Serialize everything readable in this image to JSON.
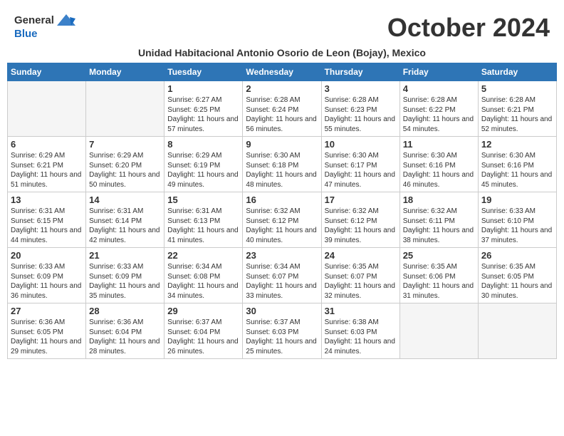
{
  "logo": {
    "text_general": "General",
    "text_blue": "Blue"
  },
  "month": "October 2024",
  "subtitle": "Unidad Habitacional Antonio Osorio de Leon (Bojay), Mexico",
  "weekdays": [
    "Sunday",
    "Monday",
    "Tuesday",
    "Wednesday",
    "Thursday",
    "Friday",
    "Saturday"
  ],
  "weeks": [
    [
      {
        "day": "",
        "info": ""
      },
      {
        "day": "",
        "info": ""
      },
      {
        "day": "1",
        "info": "Sunrise: 6:27 AM\nSunset: 6:25 PM\nDaylight: 11 hours and 57 minutes."
      },
      {
        "day": "2",
        "info": "Sunrise: 6:28 AM\nSunset: 6:24 PM\nDaylight: 11 hours and 56 minutes."
      },
      {
        "day": "3",
        "info": "Sunrise: 6:28 AM\nSunset: 6:23 PM\nDaylight: 11 hours and 55 minutes."
      },
      {
        "day": "4",
        "info": "Sunrise: 6:28 AM\nSunset: 6:22 PM\nDaylight: 11 hours and 54 minutes."
      },
      {
        "day": "5",
        "info": "Sunrise: 6:28 AM\nSunset: 6:21 PM\nDaylight: 11 hours and 52 minutes."
      }
    ],
    [
      {
        "day": "6",
        "info": "Sunrise: 6:29 AM\nSunset: 6:21 PM\nDaylight: 11 hours and 51 minutes."
      },
      {
        "day": "7",
        "info": "Sunrise: 6:29 AM\nSunset: 6:20 PM\nDaylight: 11 hours and 50 minutes."
      },
      {
        "day": "8",
        "info": "Sunrise: 6:29 AM\nSunset: 6:19 PM\nDaylight: 11 hours and 49 minutes."
      },
      {
        "day": "9",
        "info": "Sunrise: 6:30 AM\nSunset: 6:18 PM\nDaylight: 11 hours and 48 minutes."
      },
      {
        "day": "10",
        "info": "Sunrise: 6:30 AM\nSunset: 6:17 PM\nDaylight: 11 hours and 47 minutes."
      },
      {
        "day": "11",
        "info": "Sunrise: 6:30 AM\nSunset: 6:16 PM\nDaylight: 11 hours and 46 minutes."
      },
      {
        "day": "12",
        "info": "Sunrise: 6:30 AM\nSunset: 6:16 PM\nDaylight: 11 hours and 45 minutes."
      }
    ],
    [
      {
        "day": "13",
        "info": "Sunrise: 6:31 AM\nSunset: 6:15 PM\nDaylight: 11 hours and 44 minutes."
      },
      {
        "day": "14",
        "info": "Sunrise: 6:31 AM\nSunset: 6:14 PM\nDaylight: 11 hours and 42 minutes."
      },
      {
        "day": "15",
        "info": "Sunrise: 6:31 AM\nSunset: 6:13 PM\nDaylight: 11 hours and 41 minutes."
      },
      {
        "day": "16",
        "info": "Sunrise: 6:32 AM\nSunset: 6:12 PM\nDaylight: 11 hours and 40 minutes."
      },
      {
        "day": "17",
        "info": "Sunrise: 6:32 AM\nSunset: 6:12 PM\nDaylight: 11 hours and 39 minutes."
      },
      {
        "day": "18",
        "info": "Sunrise: 6:32 AM\nSunset: 6:11 PM\nDaylight: 11 hours and 38 minutes."
      },
      {
        "day": "19",
        "info": "Sunrise: 6:33 AM\nSunset: 6:10 PM\nDaylight: 11 hours and 37 minutes."
      }
    ],
    [
      {
        "day": "20",
        "info": "Sunrise: 6:33 AM\nSunset: 6:09 PM\nDaylight: 11 hours and 36 minutes."
      },
      {
        "day": "21",
        "info": "Sunrise: 6:33 AM\nSunset: 6:09 PM\nDaylight: 11 hours and 35 minutes."
      },
      {
        "day": "22",
        "info": "Sunrise: 6:34 AM\nSunset: 6:08 PM\nDaylight: 11 hours and 34 minutes."
      },
      {
        "day": "23",
        "info": "Sunrise: 6:34 AM\nSunset: 6:07 PM\nDaylight: 11 hours and 33 minutes."
      },
      {
        "day": "24",
        "info": "Sunrise: 6:35 AM\nSunset: 6:07 PM\nDaylight: 11 hours and 32 minutes."
      },
      {
        "day": "25",
        "info": "Sunrise: 6:35 AM\nSunset: 6:06 PM\nDaylight: 11 hours and 31 minutes."
      },
      {
        "day": "26",
        "info": "Sunrise: 6:35 AM\nSunset: 6:05 PM\nDaylight: 11 hours and 30 minutes."
      }
    ],
    [
      {
        "day": "27",
        "info": "Sunrise: 6:36 AM\nSunset: 6:05 PM\nDaylight: 11 hours and 29 minutes."
      },
      {
        "day": "28",
        "info": "Sunrise: 6:36 AM\nSunset: 6:04 PM\nDaylight: 11 hours and 28 minutes."
      },
      {
        "day": "29",
        "info": "Sunrise: 6:37 AM\nSunset: 6:04 PM\nDaylight: 11 hours and 26 minutes."
      },
      {
        "day": "30",
        "info": "Sunrise: 6:37 AM\nSunset: 6:03 PM\nDaylight: 11 hours and 25 minutes."
      },
      {
        "day": "31",
        "info": "Sunrise: 6:38 AM\nSunset: 6:03 PM\nDaylight: 11 hours and 24 minutes."
      },
      {
        "day": "",
        "info": ""
      },
      {
        "day": "",
        "info": ""
      }
    ]
  ]
}
